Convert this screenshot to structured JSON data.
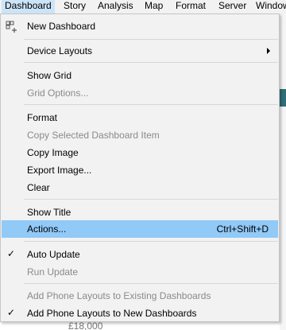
{
  "menubar": {
    "items": [
      "Dashboard",
      "Story",
      "Analysis",
      "Map",
      "Format",
      "Server",
      "Window"
    ]
  },
  "menu": {
    "new_dashboard": "New Dashboard",
    "device_layouts": "Device Layouts",
    "show_grid": "Show Grid",
    "grid_options": "Grid Options...",
    "format": "Format",
    "copy_selected_item": "Copy Selected Dashboard Item",
    "copy_image": "Copy Image",
    "export_image": "Export Image...",
    "clear": "Clear",
    "show_title": "Show Title",
    "actions": "Actions...",
    "actions_shortcut": "Ctrl+Shift+D",
    "auto_update": "Auto Update",
    "run_update": "Run Update",
    "add_phone_existing": "Add Phone Layouts to Existing Dashboards",
    "add_phone_new": "Add Phone Layouts to New Dashboards"
  },
  "background": {
    "bottom_text": "£18,000"
  },
  "colors": {
    "menu_bg": "#f2f2f2",
    "highlight": "#91c9f7",
    "disabled_text": "#8a8a8a"
  },
  "icons": {
    "new_dashboard": "new-dashboard-icon",
    "auto_update_check": "checkmark-icon",
    "add_phone_new_check": "checkmark-icon",
    "device_layouts_arrow": "submenu-arrow-icon"
  }
}
